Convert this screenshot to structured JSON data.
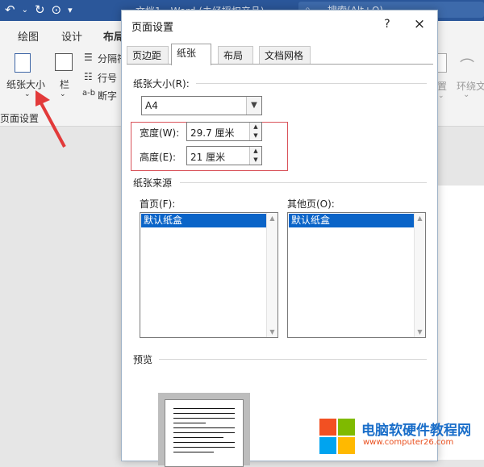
{
  "word": {
    "title": "文档1 - Word (未经授权产品)",
    "search_placeholder": "搜索(Alt+Q)",
    "ribbon_tabs": [
      "绘图",
      "设计",
      "布局"
    ],
    "ribbon": {
      "paper_size_label": "纸张大小",
      "columns_label": "栏",
      "breaks_label": "分隔符",
      "line_numbers_label": "行号",
      "hyphenation_label": "断字",
      "group_label": "页面设置",
      "position_label": "置",
      "wrap_text_label": "环绕文字"
    }
  },
  "dialog": {
    "title": "页面设置",
    "help_symbol": "?",
    "close_symbol": "×",
    "tabs": [
      {
        "label": "页边距",
        "active": false
      },
      {
        "label": "纸张",
        "active": true
      },
      {
        "label": "布局",
        "active": false
      },
      {
        "label": "文档网格",
        "active": false
      }
    ],
    "paper_size": {
      "label": "纸张大小(R):",
      "value": "A4"
    },
    "width": {
      "label": "宽度(W):",
      "value": "29.7 厘米"
    },
    "height": {
      "label": "高度(E):",
      "value": "21 厘米"
    },
    "paper_source": {
      "label": "纸张来源",
      "first_page": {
        "label": "首页(F):",
        "items": [
          "默认纸盒"
        ]
      },
      "other_pages": {
        "label": "其他页(O):",
        "items": [
          "默认纸盒"
        ]
      }
    },
    "preview_label": "预览"
  },
  "watermark": {
    "title": "电脑软硬件教程网",
    "url": "www.computer26.com"
  },
  "colors": {
    "word_blue": "#2b579a",
    "selection_blue": "#0a64c8",
    "highlight_red": "#d9535a",
    "watermark_blue": "#1a6ec9",
    "watermark_orange": "#e94d1b"
  }
}
